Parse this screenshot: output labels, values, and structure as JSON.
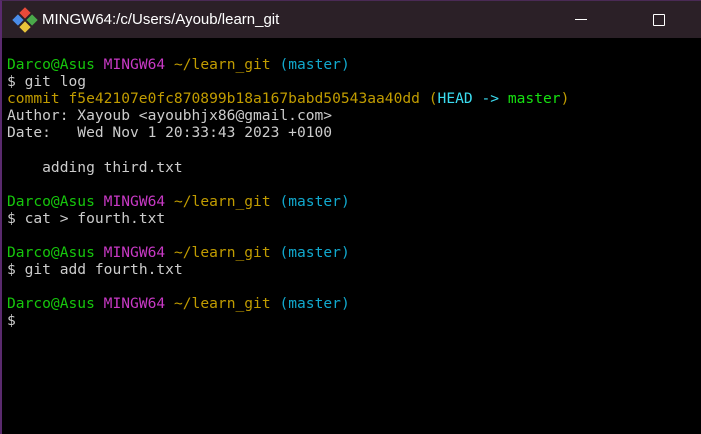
{
  "window": {
    "title": "MINGW64:/c/Users/Ayoub/learn_git",
    "icons": [
      "git-bash-icon",
      "minimize-icon",
      "maximize-icon"
    ]
  },
  "colors": {
    "user": "#16c60c",
    "system": "#c839c5",
    "path": "#c19c00",
    "branch": "#11a8cd",
    "text": "#cccccc"
  },
  "prompt": {
    "user": "Darco@Asus",
    "system": "MINGW64",
    "path": "~/learn_git",
    "branch": "(master)",
    "symbol": "$"
  },
  "terminal": {
    "cmd1": "git log",
    "commit_prefix": "commit f5e42107e0fc870899b18a167babd50543aa40dd",
    "open_paren": "(",
    "head": "HEAD ->",
    "head_branch": "master",
    "close_paren": ")",
    "author": "Author: Xayoub <ayoubhjx86@gmail.com>",
    "date": "Date:   Wed Nov 1 20:33:43 2023 +0100",
    "message": "    adding third.txt",
    "cmd2": "cat > fourth.txt",
    "cmd3": "git add fourth.txt"
  }
}
